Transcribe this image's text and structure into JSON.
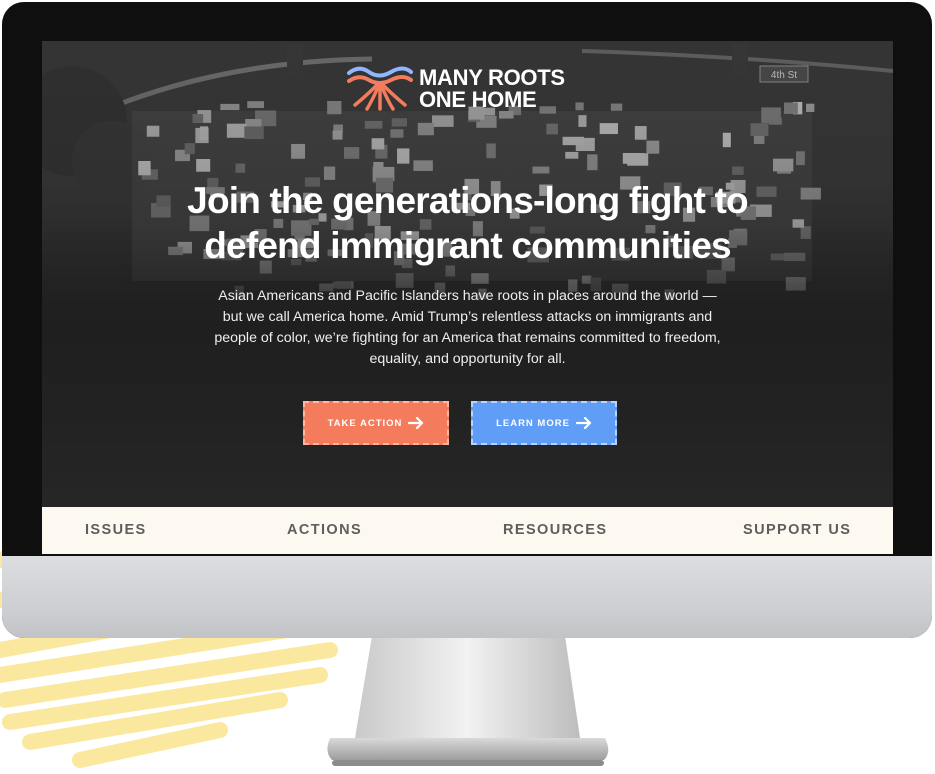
{
  "logo": {
    "line1": "MANY ROOTS",
    "line2": "ONE HOME",
    "mark_colors": [
      "#8fb6ff",
      "#f47c5d"
    ]
  },
  "hero": {
    "headline_line1": "Join the generations-long fight to",
    "headline_line2": "defend immigrant communities",
    "body": "Asian Americans and Pacific Islanders have roots in places around the world — but we call America home. Amid Trump’s relentless attacks on immigrants and people of color, we’re fighting for an America that remains committed to freedom, equality, and opportunity for all.",
    "street_sign": "4th St"
  },
  "buttons": [
    {
      "label": "TAKE ACTION",
      "icon": "arrow-right-icon",
      "color": "#f47c5d"
    },
    {
      "label": "LEARN MORE",
      "icon": "arrow-right-icon",
      "color": "#5f9df7"
    }
  ],
  "nav": {
    "items": [
      {
        "label": "ISSUES"
      },
      {
        "label": "ACTIONS"
      },
      {
        "label": "RESOURCES"
      },
      {
        "label": "SUPPORT US"
      }
    ]
  },
  "colors": {
    "accent_coral": "#f47c5d",
    "accent_blue": "#5f9df7",
    "nav_background": "#fdf9f1",
    "scribble_yellow": "#fbe79a"
  }
}
